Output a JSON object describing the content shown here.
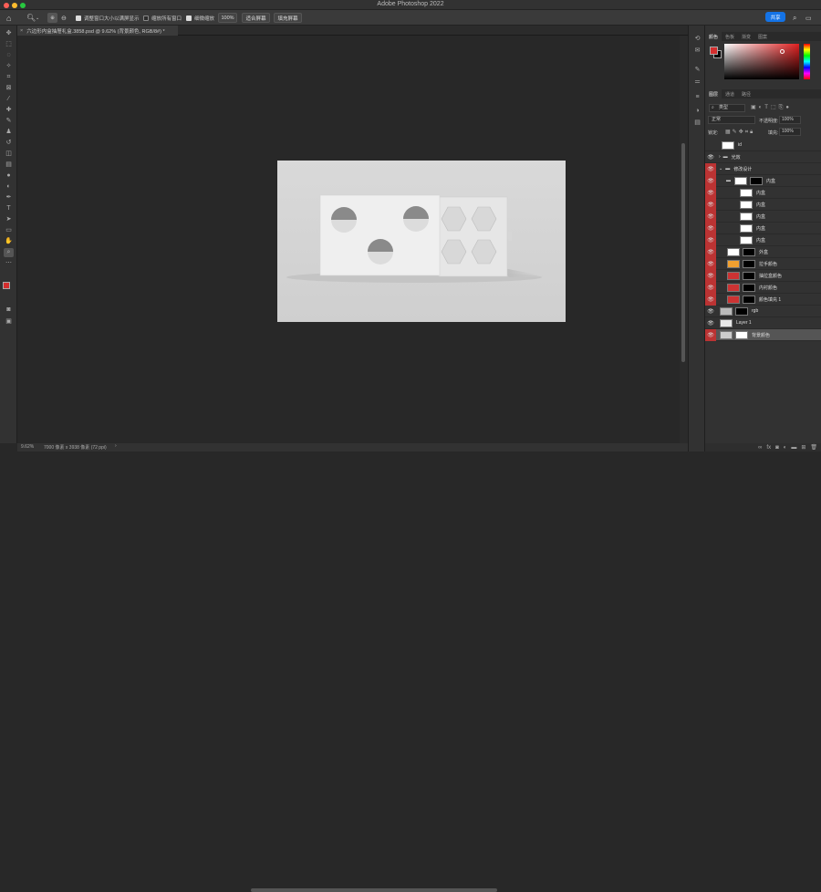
{
  "app": {
    "title": "Adobe Photoshop 2022"
  },
  "options": {
    "opt1": "调整窗口大小以满屏显示",
    "opt2": "缩放所有窗口",
    "opt3": "细微缩放",
    "zoom": "100%",
    "fit": "适合屏幕",
    "fill": "填充屏幕"
  },
  "share": "共享",
  "doc_tab": "六边形内盒抽屉礼盒.3858.psd @ 9.62% (背景颜色, RGB/8#) *",
  "status": {
    "zoom": "9.62%",
    "size": "7000 像素 x 3938 像素 (72 ppi)"
  },
  "color_panel": {
    "tabs": [
      "颜色",
      "色板",
      "渐变",
      "图案"
    ]
  },
  "layers_panel": {
    "tabs": [
      "图层",
      "通道",
      "路径"
    ],
    "filter": "类型",
    "blend": "正常",
    "opacity_label": "不透明度:",
    "opacity": "100%",
    "lock_label": "锁定:",
    "fill_label": "填充:",
    "fill": "100%",
    "layers": [
      {
        "name": "id"
      },
      {
        "name": "光效"
      },
      {
        "name": "修改设计"
      },
      {
        "name": "内盒"
      },
      {
        "name": "内盒"
      },
      {
        "name": "内盒"
      },
      {
        "name": "内盒"
      },
      {
        "name": "内盒"
      },
      {
        "name": "内盒"
      },
      {
        "name": "外盒"
      },
      {
        "name": "拉手颜色"
      },
      {
        "name": "抽拉盒颜色"
      },
      {
        "name": "内衬颜色"
      },
      {
        "name": "颜色填充 1"
      },
      {
        "name": "rgb"
      },
      {
        "name": "Layer 1"
      },
      {
        "name": "背景颜色"
      }
    ]
  },
  "colors": {
    "accent": "#1473e6",
    "fg": "#d42e2e",
    "red_tag": "#b33333"
  }
}
